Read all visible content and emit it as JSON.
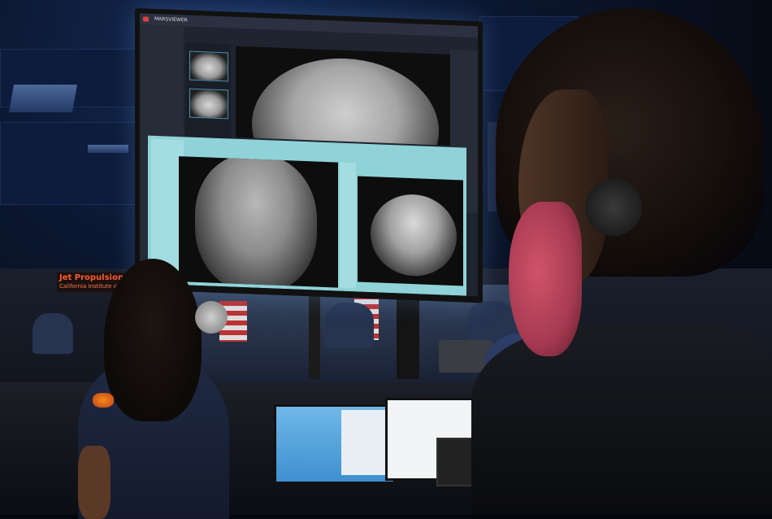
{
  "scene": {
    "description_label": "Mission control room with large monitor",
    "sign": {
      "line1": "Jet Propulsion L",
      "line2": "California Institute o"
    },
    "monitor": {
      "app_name": "MARSVIEWER"
    }
  },
  "colors": {
    "dialog_teal": "#8fd3d8",
    "sign_orange": "#ff5a2a",
    "mask_red": "#a63a52"
  },
  "icons": [
    "headset-icon",
    "app-logo-icon"
  ]
}
